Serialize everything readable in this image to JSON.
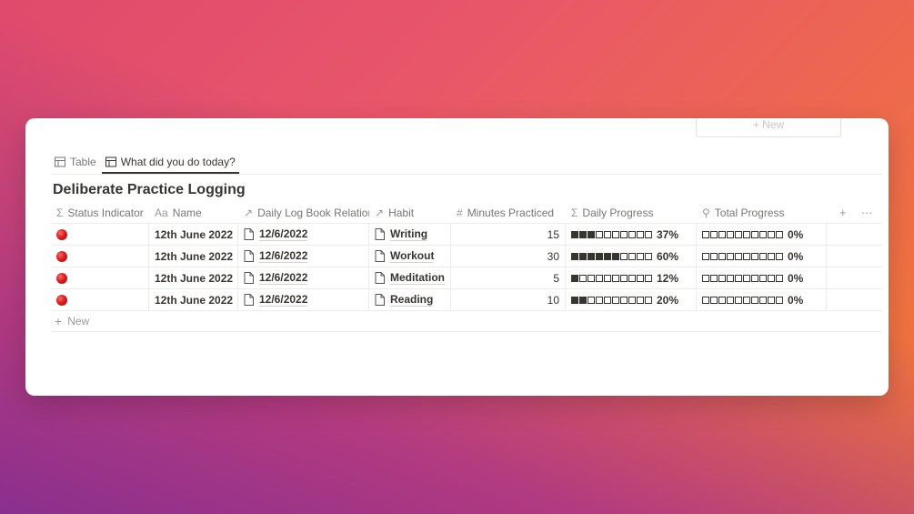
{
  "top": {
    "ghost_new_label": "+ New"
  },
  "tabs": [
    {
      "label": "Table",
      "icon": "table-icon",
      "active": false
    },
    {
      "label": "What did you do today?",
      "icon": "table-icon",
      "active": true
    }
  ],
  "database": {
    "title": "Deliberate Practice Logging"
  },
  "columns": [
    {
      "icon": "Σ",
      "label": "Status Indicator"
    },
    {
      "icon": "Aa",
      "label": "Name"
    },
    {
      "icon": "↗",
      "label": "Daily Log Book Relation"
    },
    {
      "icon": "↗",
      "label": "Habit"
    },
    {
      "icon": "#",
      "label": "Minutes Practiced"
    },
    {
      "icon": "Σ",
      "label": "Daily Progress"
    },
    {
      "icon": "⚲",
      "label": "Total Progress"
    }
  ],
  "header_actions": {
    "add": "+",
    "more": "···"
  },
  "rows": [
    {
      "name": "12th June 2022",
      "relation": "12/6/2022",
      "habit": "Writing",
      "minutes": "15",
      "daily_filled": 3,
      "daily_pct": "37%",
      "total_filled": 0,
      "total_pct": "0%"
    },
    {
      "name": "12th June 2022",
      "relation": "12/6/2022",
      "habit": "Workout",
      "minutes": "30",
      "daily_filled": 6,
      "daily_pct": "60%",
      "total_filled": 0,
      "total_pct": "0%"
    },
    {
      "name": "12th June 2022",
      "relation": "12/6/2022",
      "habit": "Meditation",
      "minutes": "5",
      "daily_filled": 1,
      "daily_pct": "12%",
      "total_filled": 0,
      "total_pct": "0%"
    },
    {
      "name": "12th June 2022",
      "relation": "12/6/2022",
      "habit": "Reading",
      "minutes": "10",
      "daily_filled": 2,
      "daily_pct": "20%",
      "total_filled": 0,
      "total_pct": "0%"
    }
  ],
  "progress_squares_total": 10,
  "new_row": {
    "label": "New"
  },
  "colors": {
    "status_dot": "#e01b1b",
    "text": "#37352f",
    "muted": "#787774"
  }
}
